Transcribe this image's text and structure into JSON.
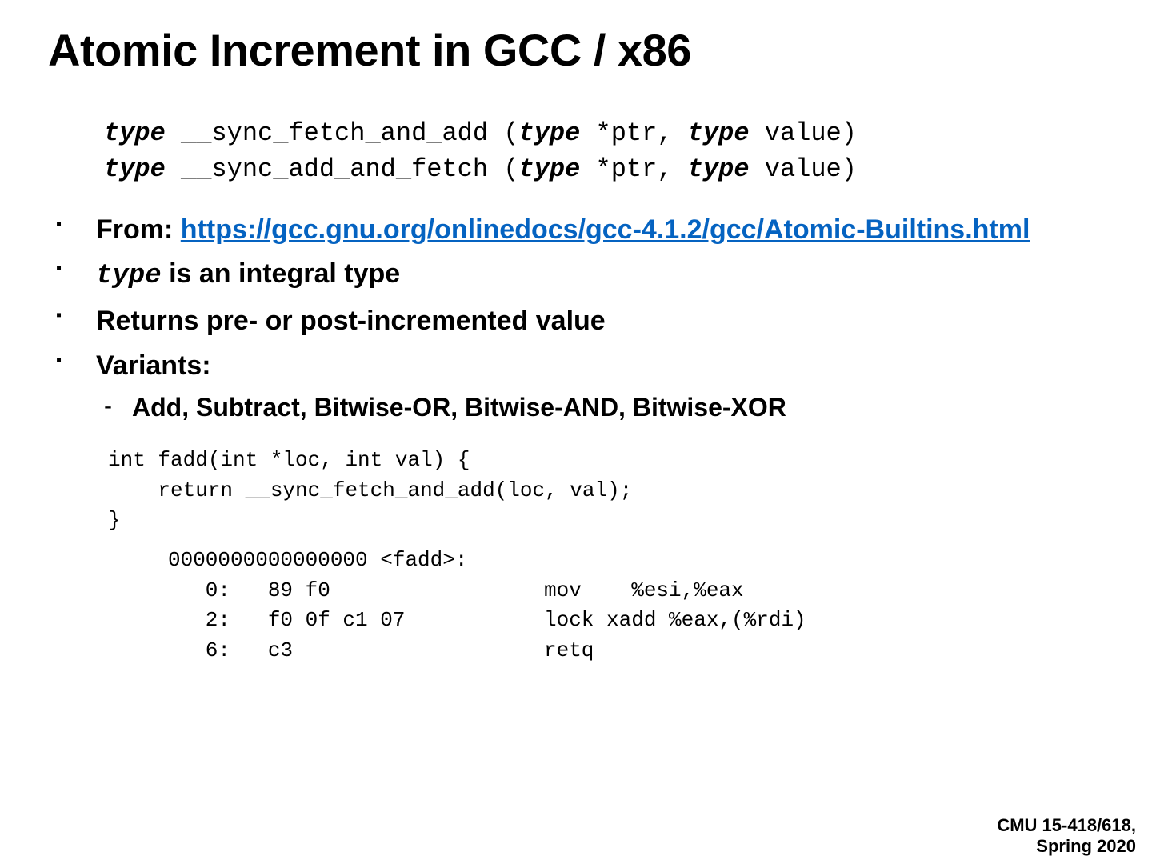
{
  "title": "Atomic Increment in GCC / x86",
  "proto": {
    "l1_pre": "type",
    "l1_mid": " __sync_fetch_and_add (",
    "l1_a": "type",
    "l1_b": " *ptr, ",
    "l1_c": "type",
    "l1_end": " value)",
    "l2_pre": "type",
    "l2_mid": " __sync_add_and_fetch (",
    "l2_a": "type",
    "l2_b": " *ptr, ",
    "l2_c": "type",
    "l2_end": " value)"
  },
  "bullets": {
    "from_label": "From: ",
    "from_link": "https://gcc.gnu.org/onlinedocs/gcc-4.1.2/gcc/Atomic-Builtins.html",
    "type_word": "type",
    "type_rest": " is an integral type",
    "returns": "Returns pre- or post-incremented value",
    "variants": "Variants:",
    "variants_sub": "Add, Subtract, Bitwise-OR, Bitwise-AND, Bitwise-XOR"
  },
  "code": {
    "l1": "int fadd(int *loc, int val) {",
    "l2": "    return __sync_fetch_and_add(loc, val);",
    "l3": "}"
  },
  "asm": {
    "hdr": "0000000000000000 <fadd>:",
    "r1c1": "   0:   89 f0",
    "r1c2": "mov    %esi,%eax",
    "r2c1": "   2:   f0 0f c1 07",
    "r2c2": "lock xadd %eax,(%rdi)",
    "r3c1": "   6:   c3",
    "r3c2": "retq"
  },
  "footer": {
    "l1": "CMU 15-418/618,",
    "l2": "Spring 2020"
  }
}
